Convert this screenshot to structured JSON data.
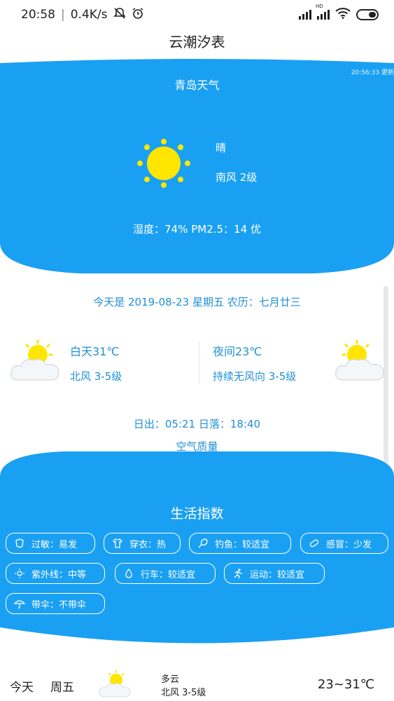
{
  "status_bar": {
    "time": "20:58",
    "separator": "|",
    "speed": "0.4K/s",
    "network_badge": "HD"
  },
  "app": {
    "title": "云潮汐表"
  },
  "current": {
    "update_time": "20:56:33 更新",
    "city": "青岛天气",
    "condition": "晴",
    "wind": "南风 2级",
    "humidity_line": "湿度：74% PM2.5：14 优"
  },
  "today": {
    "date_line": "今天是 2019-08-23 星期五 农历：七月廿三",
    "day_temp": "白天31℃",
    "day_wind": "北风 3-5级",
    "night_temp": "夜间23℃",
    "night_wind": "持续无风向 3-5级",
    "sun_line": "日出：05:21 日落：18:40",
    "air_quality": "空气质量"
  },
  "life_index": {
    "title": "生活指数",
    "items": [
      {
        "label": "过敏：易发",
        "icon": "allergy-icon"
      },
      {
        "label": "穿衣：热",
        "icon": "clothing-icon"
      },
      {
        "label": "钓鱼：较适宜",
        "icon": "fishing-icon"
      },
      {
        "label": "感冒：少发",
        "icon": "cold-icon"
      },
      {
        "label": "紫外线：中等",
        "icon": "uv-icon"
      },
      {
        "label": "行车：较适宜",
        "icon": "driving-icon"
      },
      {
        "label": "运动：较适宜",
        "icon": "sport-icon"
      },
      {
        "label": "带伞：不带伞",
        "icon": "umbrella-icon"
      }
    ]
  },
  "forecast": {
    "day_label": "今天",
    "weekday": "周五",
    "condition": "多云",
    "wind": "北风 3-5级",
    "temp_range": "23~31℃"
  },
  "colors": {
    "brand_blue": "#1aa0f2",
    "text_blue": "#1f8fd6",
    "sun_yellow": "#ffe600"
  }
}
